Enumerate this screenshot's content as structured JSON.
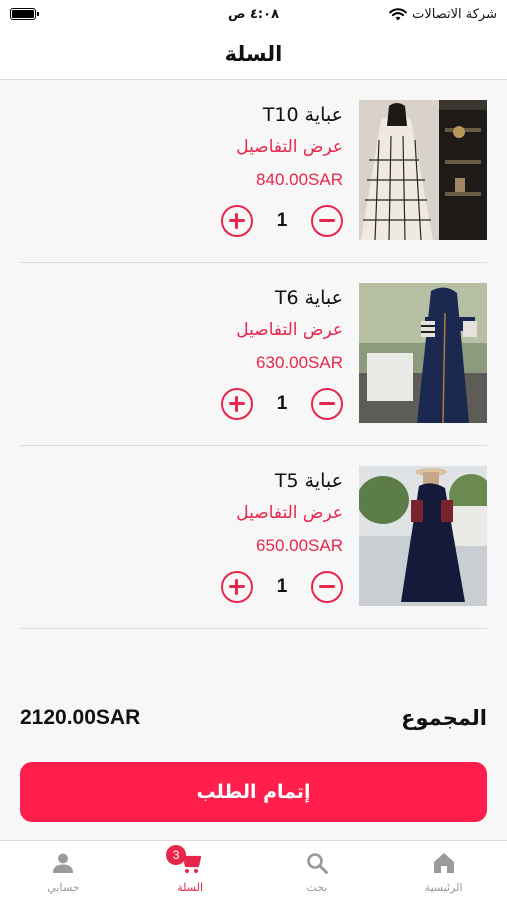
{
  "status_bar": {
    "carrier": "شركة الاتصالات",
    "time": "٤:٠٨ ص"
  },
  "header": {
    "title": "السلة"
  },
  "cart": {
    "items": [
      {
        "name": "عباية T10",
        "details_label": "عرض التفاصيل",
        "price": "840.00SAR",
        "quantity": "1",
        "image_icon": "abaya-photo-icon"
      },
      {
        "name": "عباية T6",
        "details_label": "عرض التفاصيل",
        "price": "630.00SAR",
        "quantity": "1",
        "image_icon": "abaya-photo-icon"
      },
      {
        "name": "عباية T5",
        "details_label": "عرض التفاصيل",
        "price": "650.00SAR",
        "quantity": "1",
        "image_icon": "abaya-photo-icon"
      }
    ]
  },
  "summary": {
    "total_label": "المجموع",
    "total_value": "2120.00SAR"
  },
  "checkout": {
    "label": "إتمام الطلب"
  },
  "tab_bar": {
    "tabs": [
      {
        "label": "حسابي",
        "icon": "person-icon"
      },
      {
        "label": "السلة",
        "icon": "cart-icon",
        "badge": "3",
        "active": true
      },
      {
        "label": "بحث",
        "icon": "search-icon"
      },
      {
        "label": "الرئيسية",
        "icon": "home-icon"
      }
    ]
  },
  "colors": {
    "accent": "#e8264c",
    "checkout_button": "#ff1e4c",
    "tab_inactive": "#9a9a9a"
  }
}
